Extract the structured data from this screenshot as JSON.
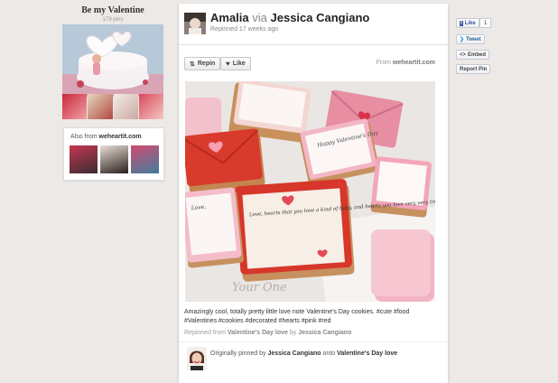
{
  "board": {
    "title": "Be my Valentine",
    "pin_count": "179 pins",
    "also_from_label": "Also from",
    "also_from_source": "weheartit.com"
  },
  "pin": {
    "pinner_name": "Amalia",
    "via_label": "via",
    "via_name": "Jessica Cangiano",
    "repinned_time": "Repinned 17 weeks ago",
    "repin_label": "Repin",
    "like_label": "Like",
    "from_label": "From",
    "from_source": "weheartit.com",
    "description": "Amazingly cool, totally pretty little love note Valentine's Day cookies. #cute #food #Valentines #cookies #decorated #hearts #pink #red",
    "repinned_from_label": "Repinned from",
    "repinned_from_board": "Valentine's Day love",
    "repinned_from_by": "by",
    "repinned_from_user": "Jessica Cangiano",
    "originally_label": "Originally pinned by",
    "originally_user": "Jessica Cangiano",
    "onto_label": "onto",
    "originally_board": "Valentine's Day love",
    "image_texts": {
      "cookie_1": "Happy Valentine's Day",
      "cookie_2": "Love, hearts that you love a kind of baby, and hearts you love very very truly",
      "cookie_3": "Love,",
      "paper": "Your One"
    }
  },
  "social": {
    "fb_like_label": "Like",
    "fb_count": "1",
    "tweet_label": "Tweet",
    "embed_label": "Embed",
    "report_label": "Report Pin"
  },
  "colors": {
    "background": "#ece9e6",
    "link_bold": "#333333",
    "cookie_red": "#d83a2c",
    "cookie_pink": "#f2b8c6",
    "facebook_blue": "#3b5998"
  }
}
